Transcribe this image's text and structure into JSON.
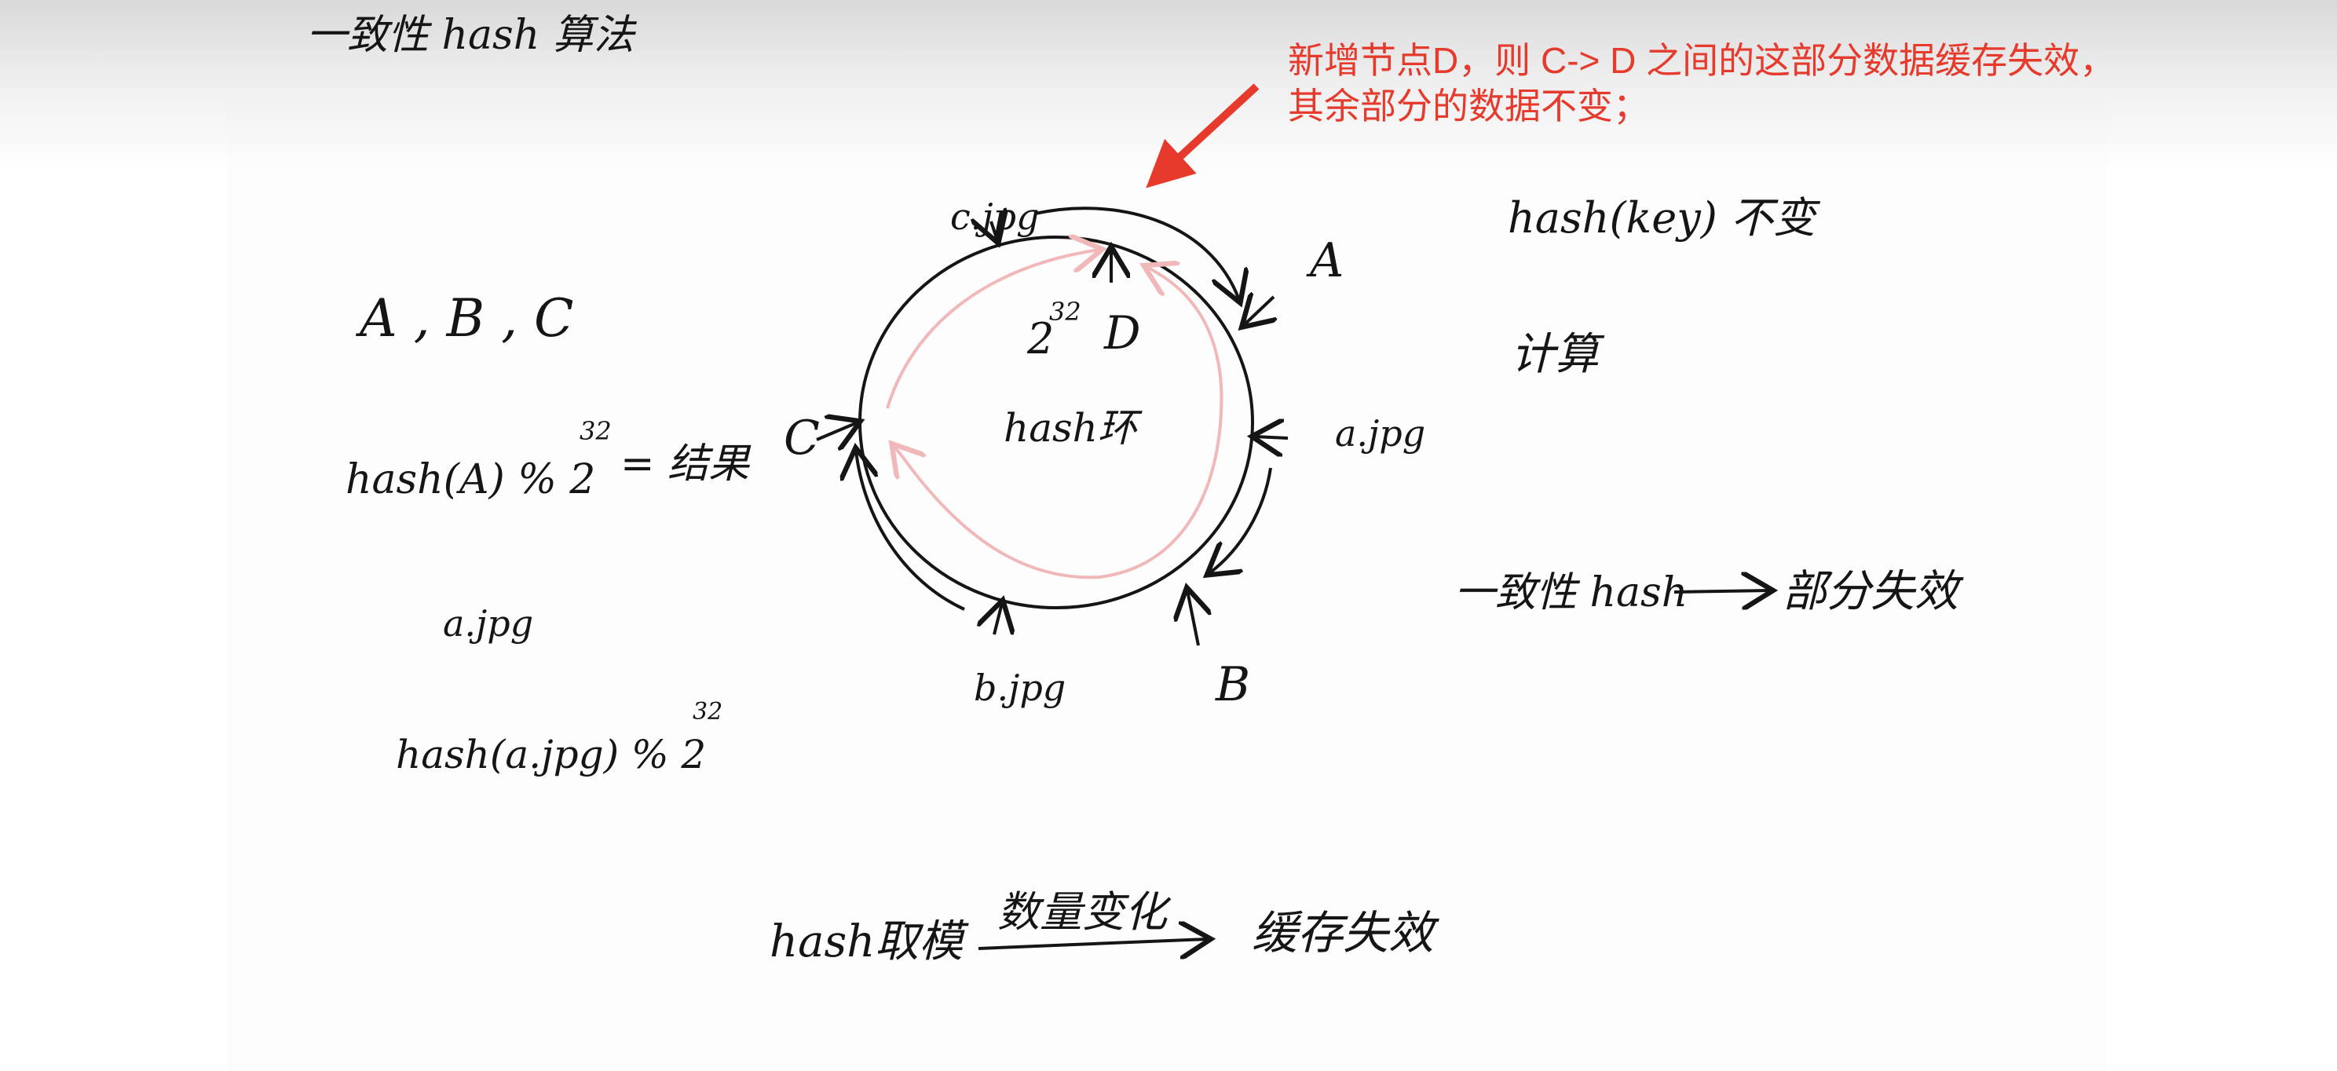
{
  "callout": {
    "line1": "新增节点D，则 C-> D 之间的这部分数据缓存失效，",
    "line2": "其余部分的数据不变；",
    "color": "#e53a2c"
  },
  "notes": {
    "title": "一致性 hash 算法",
    "nodes_list": "A , B , C",
    "node_hash_formula": "hash(A) % 2",
    "node_hash_exp": "32",
    "node_hash_result": "= 结果",
    "file_name": "a.jpg",
    "file_hash_formula": "hash(a.jpg) % 2",
    "file_hash_exp": "32",
    "key_unchanged": "hash(key) 不变",
    "compute": "计算",
    "consistent_hash": "一致性 hash",
    "partial_invalid": "部分失效",
    "hash_mod": "hash取模",
    "count_change": "数量变化",
    "cache_invalid": "缓存失效"
  },
  "ring": {
    "label": "hash环",
    "top_value": "2",
    "top_exp": "32",
    "node_a": "A",
    "node_b": "B",
    "node_c": "C",
    "node_d": "D",
    "file_a": "a.jpg",
    "file_b": "b.jpg",
    "file_c": "c.jpg"
  }
}
